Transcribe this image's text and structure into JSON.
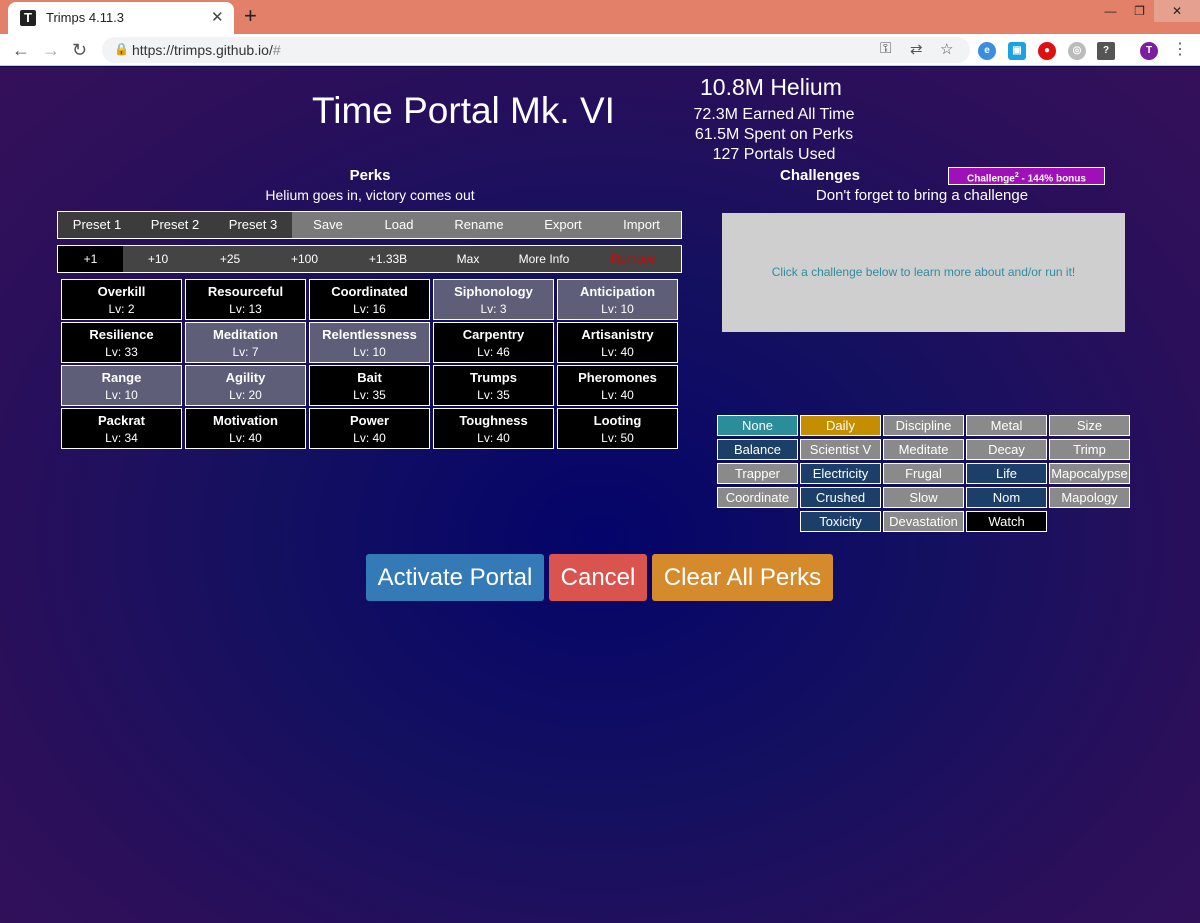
{
  "browser": {
    "tab_title": "Trimps 4.11.3",
    "favicon_letter": "T",
    "url_main": "https://trimps.github.io/",
    "url_suffix": "#",
    "profile_letter": "T"
  },
  "portal": {
    "title": "Time Portal Mk. VI",
    "helium": "10.8M Helium",
    "earned": "72.3M Earned All Time",
    "spent": "61.5M Spent on Perks",
    "portals": "127 Portals Used"
  },
  "perks": {
    "heading": "Perks",
    "subheading": "Helium goes in, victory comes out",
    "presets": [
      "Preset 1",
      "Preset 2",
      "Preset 3",
      "Save",
      "Load",
      "Rename",
      "Export",
      "Import"
    ],
    "buy_amounts": [
      "+1",
      "+10",
      "+25",
      "+100",
      "+1.33B",
      "Max",
      "More Info",
      "Remove"
    ],
    "grid": [
      {
        "name": "Overkill",
        "lv": "Lv: 2"
      },
      {
        "name": "Resourceful",
        "lv": "Lv: 13"
      },
      {
        "name": "Coordinated",
        "lv": "Lv: 16"
      },
      {
        "name": "Siphonology",
        "lv": "Lv: 3"
      },
      {
        "name": "Anticipation",
        "lv": "Lv: 10"
      },
      {
        "name": "Resilience",
        "lv": "Lv: 33"
      },
      {
        "name": "Meditation",
        "lv": "Lv: 7"
      },
      {
        "name": "Relentlessness",
        "lv": "Lv: 10"
      },
      {
        "name": "Carpentry",
        "lv": "Lv: 46"
      },
      {
        "name": "Artisanistry",
        "lv": "Lv: 40"
      },
      {
        "name": "Range",
        "lv": "Lv: 10"
      },
      {
        "name": "Agility",
        "lv": "Lv: 20"
      },
      {
        "name": "Bait",
        "lv": "Lv: 35"
      },
      {
        "name": "Trumps",
        "lv": "Lv: 35"
      },
      {
        "name": "Pheromones",
        "lv": "Lv: 40"
      },
      {
        "name": "Packrat",
        "lv": "Lv: 34"
      },
      {
        "name": "Motivation",
        "lv": "Lv: 40"
      },
      {
        "name": "Power",
        "lv": "Lv: 40"
      },
      {
        "name": "Toughness",
        "lv": "Lv: 40"
      },
      {
        "name": "Looting",
        "lv": "Lv: 50"
      }
    ]
  },
  "challenges": {
    "heading": "Challenges",
    "subheading": "Don't forget to bring a challenge",
    "c2_label": "Challenge",
    "c2_sup": "2",
    "c2_bonus": " - 144% bonus",
    "info": "Click a challenge below to learn more about and/or run it!",
    "grid": [
      "None",
      "Daily",
      "Discipline",
      "Metal",
      "Size",
      "Balance",
      "Scientist V",
      "Meditate",
      "Decay",
      "Trimp",
      "Trapper",
      "Electricity",
      "Frugal",
      "Life",
      "Mapocalypse",
      "Coordinate",
      "Crushed",
      "Slow",
      "Nom",
      "Mapology",
      "",
      "Toxicity",
      "Devastation",
      "Watch",
      ""
    ]
  },
  "actions": {
    "activate": "Activate Portal",
    "cancel": "Cancel",
    "clear": "Clear All Perks"
  },
  "colors": {
    "activate": "#337ab7",
    "cancel": "#d9534f",
    "clear": "#d58a2b"
  }
}
